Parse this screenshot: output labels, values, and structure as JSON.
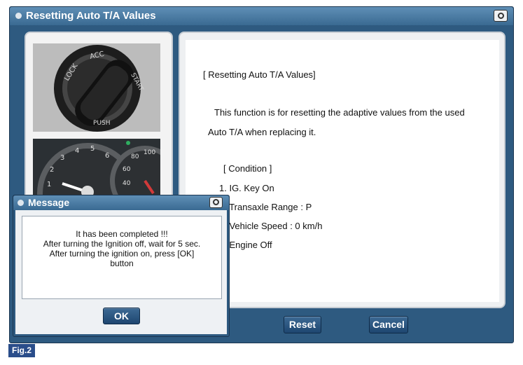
{
  "window": {
    "title": "Resetting Auto T/A Values",
    "title_icon": "dot-icon",
    "camera_icon": "camera-icon"
  },
  "images": {
    "ignition_labels": [
      "LOCK",
      "ACC",
      "START",
      "PUSH"
    ],
    "gauge_labels": [
      "3",
      "4",
      "5",
      "6",
      "2",
      "1",
      "80",
      "100",
      "60",
      "40"
    ]
  },
  "content": {
    "heading": "[ Resetting Auto T/A Values]",
    "desc_line1": "This function is for resetting the adaptive values from the used",
    "desc_line2": "Auto T/A when replacing it.",
    "condition_title": "[ Condition ]",
    "condition_1": "1. IG. Key On",
    "condition_2": "2. Transaxle Range : P",
    "condition_3": "3. Vehicle Speed : 0 km/h",
    "condition_4": "4. Engine Off"
  },
  "buttons": {
    "reset": "Reset",
    "cancel": "Cancel"
  },
  "dialog": {
    "title": "Message",
    "line1": "It has been completed !!!",
    "line2": "After turning the Ignition off, wait for 5 sec.",
    "line3": "After turning the ignition on,  press [OK]",
    "line4": "button",
    "ok": "OK"
  },
  "figure_label": "Fig.2",
  "colors": {
    "window_frame": "#2e5a80",
    "title_bar": "#4b7aa3",
    "button": "#1e4670",
    "figure_badge": "#2a4d8a"
  }
}
